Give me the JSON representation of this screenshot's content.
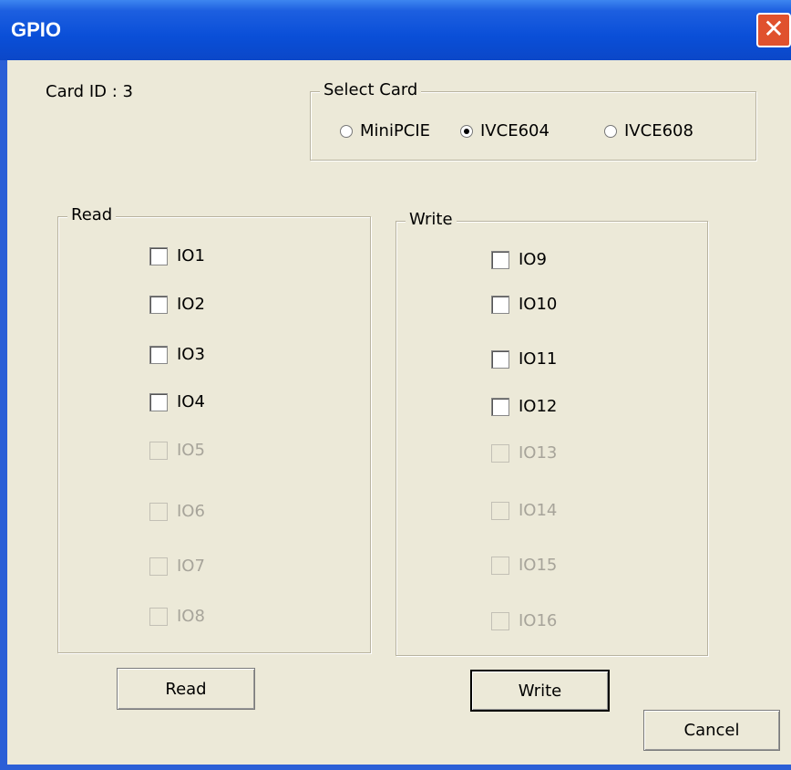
{
  "window": {
    "title": "GPIO",
    "close_glyph": "✕"
  },
  "card_id": {
    "label": "Card ID : 3"
  },
  "select_card": {
    "legend": "Select Card",
    "options": [
      {
        "label": "MiniPCIE",
        "checked": false
      },
      {
        "label": "IVCE604",
        "checked": true
      },
      {
        "label": "IVCE608",
        "checked": false
      }
    ]
  },
  "read_group": {
    "legend": "Read",
    "items": [
      {
        "label": "IO1",
        "enabled": true
      },
      {
        "label": "IO2",
        "enabled": true
      },
      {
        "label": "IO3",
        "enabled": true
      },
      {
        "label": "IO4",
        "enabled": true
      },
      {
        "label": "IO5",
        "enabled": false
      },
      {
        "label": "IO6",
        "enabled": false
      },
      {
        "label": "IO7",
        "enabled": false
      },
      {
        "label": "IO8",
        "enabled": false
      }
    ]
  },
  "write_group": {
    "legend": "Write",
    "items": [
      {
        "label": "IO9",
        "enabled": true
      },
      {
        "label": "IO10",
        "enabled": true
      },
      {
        "label": "IO11",
        "enabled": true
      },
      {
        "label": "IO12",
        "enabled": true
      },
      {
        "label": "IO13",
        "enabled": false
      },
      {
        "label": "IO14",
        "enabled": false
      },
      {
        "label": "IO15",
        "enabled": false
      },
      {
        "label": "IO16",
        "enabled": false
      }
    ]
  },
  "buttons": {
    "read": "Read",
    "write": "Write",
    "cancel": "Cancel"
  },
  "colors": {
    "titlebar": "#0a4fd8",
    "dialog_bg": "#ece9d8",
    "close": "#e0512d",
    "disabled_text": "#a7a49a"
  }
}
